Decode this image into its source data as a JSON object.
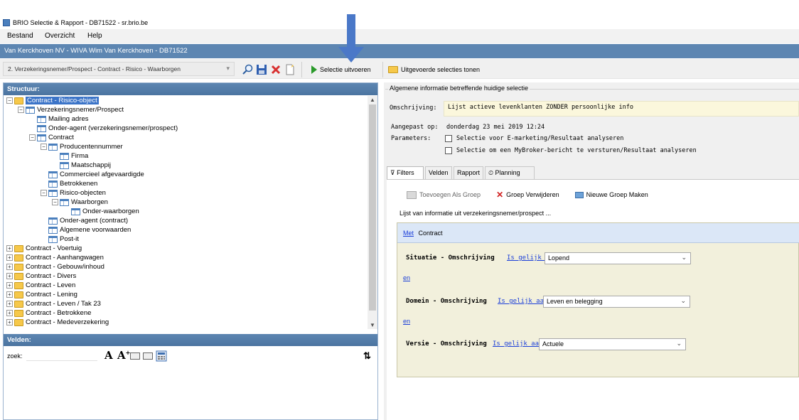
{
  "window": {
    "title": "BRIO Selectie & Rapport - DB71522 - sr.brio.be"
  },
  "menu": {
    "items": [
      "Bestand",
      "Overzicht",
      "Help"
    ]
  },
  "context_bar": {
    "text": "Van Kerckhoven NV - WIVA Wim Van Kerckhoven - DB71522"
  },
  "toolbar": {
    "selection_dropdown": "2. Verzekeringsnemer/Prospect - Contract - Risico - Waarborgen",
    "run_label": "Selectie uitvoeren",
    "executed_label": "Uitgevoerde selecties tonen"
  },
  "structure": {
    "header": "Structuur:",
    "tree": [
      {
        "label": "Contract - Risico-object",
        "exp": "−",
        "icon": "folder",
        "selected": true
      },
      {
        "label": "Verzekeringsnemer/Prospect",
        "exp": "−",
        "icon": "table"
      },
      {
        "label": "Mailing adres",
        "exp": "",
        "icon": "table"
      },
      {
        "label": "Onder-agent (verzekeringsnemer/prospect)",
        "exp": "",
        "icon": "table"
      },
      {
        "label": "Contract",
        "exp": "−",
        "icon": "table"
      },
      {
        "label": "Producentennummer",
        "exp": "−",
        "icon": "table"
      },
      {
        "label": "Firma",
        "exp": "",
        "icon": "table"
      },
      {
        "label": "Maatschappij",
        "exp": "",
        "icon": "table"
      },
      {
        "label": "Commercieel afgevaardigde",
        "exp": "",
        "icon": "table"
      },
      {
        "label": "Betrokkenen",
        "exp": "",
        "icon": "table"
      },
      {
        "label": "Risico-objecten",
        "exp": "−",
        "icon": "table"
      },
      {
        "label": "Waarborgen",
        "exp": "−",
        "icon": "table"
      },
      {
        "label": "Onder-waarborgen",
        "exp": "",
        "icon": "table"
      },
      {
        "label": "Onder-agent (contract)",
        "exp": "",
        "icon": "table"
      },
      {
        "label": "Algemene voorwaarden",
        "exp": "",
        "icon": "table"
      },
      {
        "label": "Post-it",
        "exp": "",
        "icon": "table"
      },
      {
        "label": "Contract - Voertuig",
        "exp": "+",
        "icon": "folder"
      },
      {
        "label": "Contract - Aanhangwagen",
        "exp": "+",
        "icon": "folder"
      },
      {
        "label": "Contract - Gebouw/inhoud",
        "exp": "+",
        "icon": "folder"
      },
      {
        "label": "Contract - Divers",
        "exp": "+",
        "icon": "folder"
      },
      {
        "label": "Contract - Leven",
        "exp": "+",
        "icon": "folder"
      },
      {
        "label": "Contract - Lening",
        "exp": "+",
        "icon": "folder"
      },
      {
        "label": "Contract - Leven / Tak 23",
        "exp": "+",
        "icon": "folder"
      },
      {
        "label": "Contract - Betrokkene",
        "exp": "+",
        "icon": "folder"
      },
      {
        "label": "Contract - Medeverzekering",
        "exp": "+",
        "icon": "folder"
      }
    ]
  },
  "fields": {
    "header": "Velden:",
    "search_label": "zoek:",
    "search_value": ""
  },
  "general_info": {
    "title": "Algemene informatie betreffende huidige selectie",
    "description_label": "Omschrijving:",
    "description": "Lijst actieve levenklanten ZONDER  persoonlijke info",
    "modified_label": "Aangepast op:",
    "modified_value": "donderdag 23 mei 2019 12:24",
    "parameters_label": "Parameters:",
    "param1": "Selectie voor E-marketing/Resultaat analyseren",
    "param2": "Selectie om een MyBroker-bericht te versturen/Resultaat analyseren"
  },
  "tabs": [
    "Filters",
    "Velden",
    "Rapport",
    "Planning"
  ],
  "filters": {
    "add_group": "Toevoegen Als Groep",
    "delete_group": "Groep Verwijderen",
    "new_group": "Nieuwe Groep Maken",
    "list_text": "Lijst van informatie uit verzekeringsnemer/prospect ...",
    "group_with": "Met",
    "group_entity": "Contract",
    "and_label": "en",
    "conditions": [
      {
        "field": "Situatie - Omschrijving",
        "operator": "Is gelijk aan",
        "value": "Lopend"
      },
      {
        "field": "Domein - Omschrijving",
        "operator": "Is gelijk aan",
        "value": "Leven en belegging"
      },
      {
        "field": "Versie - Omschrijving",
        "operator": "Is gelijk aan",
        "value": "Actuele"
      }
    ]
  }
}
